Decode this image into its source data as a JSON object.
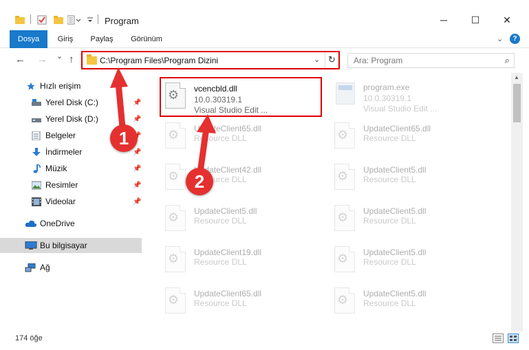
{
  "window": {
    "title": "Program",
    "minimize": "─",
    "maximize": "☐",
    "close": "✕"
  },
  "ribbon": {
    "tabs": [
      "Dosya",
      "Giriş",
      "Paylaş",
      "Görünüm"
    ],
    "help": "?"
  },
  "navigation": {
    "back": "←",
    "forward": "→",
    "recent": "⌄",
    "up": "↑",
    "address": "C:\\Program Files\\Program Dizini",
    "refresh": "↻",
    "search_placeholder": "Ara: Program",
    "search_icon": "⌕"
  },
  "sidebar": {
    "items": [
      {
        "label": "Hızlı erişim",
        "icon": "star-icon",
        "pinned": false
      },
      {
        "label": "Yerel Disk (C:)",
        "icon": "drive-icon",
        "pinned": true
      },
      {
        "label": "Yerel Disk (D:)",
        "icon": "drive-icon",
        "pinned": true
      },
      {
        "label": "Belgeler",
        "icon": "documents-icon",
        "pinned": true
      },
      {
        "label": "İndirmeler",
        "icon": "download-icon",
        "pinned": true
      },
      {
        "label": "Müzik",
        "icon": "music-icon",
        "pinned": true
      },
      {
        "label": "Resimler",
        "icon": "pictures-icon",
        "pinned": true
      },
      {
        "label": "Videolar",
        "icon": "videos-icon",
        "pinned": true
      },
      {
        "label": "OneDrive",
        "icon": "cloud-icon",
        "pinned": false
      },
      {
        "label": "Bu bilgisayar",
        "icon": "computer-icon",
        "pinned": false,
        "selected": true
      },
      {
        "label": "Ağ",
        "icon": "network-icon",
        "pinned": false
      }
    ]
  },
  "files": {
    "left": [
      {
        "name": "vcencbld.dll",
        "line2": "10.0.30319.1",
        "line3": "Visual Studio Edit ...",
        "highlighted": true
      },
      {
        "name": "UpdateClient65.dll",
        "line2": "Resource DLL"
      },
      {
        "name": "UpdateClient42.dll",
        "line2": "Resource DLL"
      },
      {
        "name": "UpdateClient5.dll",
        "line2": "Resource DLL"
      },
      {
        "name": "UpdateClient19.dll",
        "line2": "Resource DLL"
      },
      {
        "name": "UpdateClient65.dll",
        "line2": "Resource DLL"
      }
    ],
    "right": [
      {
        "name": "program.exe",
        "line2": "10.0.30319.1",
        "line3": "Visual Studio Edit ...",
        "exe": true
      },
      {
        "name": "UpdateClient65.dll",
        "line2": "Resource DLL"
      },
      {
        "name": "UpdateClient5.dll",
        "line2": "Resource DLL"
      },
      {
        "name": "UpdateClient5.dll",
        "line2": "Resource DLL"
      },
      {
        "name": "UpdateClient5.dll",
        "line2": "Resource DLL"
      },
      {
        "name": "UpdateClient5.dll",
        "line2": "Resource DLL"
      }
    ]
  },
  "status": {
    "count": "174 öğe"
  },
  "annotations": {
    "step1": "1",
    "step2": "2",
    "color": "#e53030"
  }
}
